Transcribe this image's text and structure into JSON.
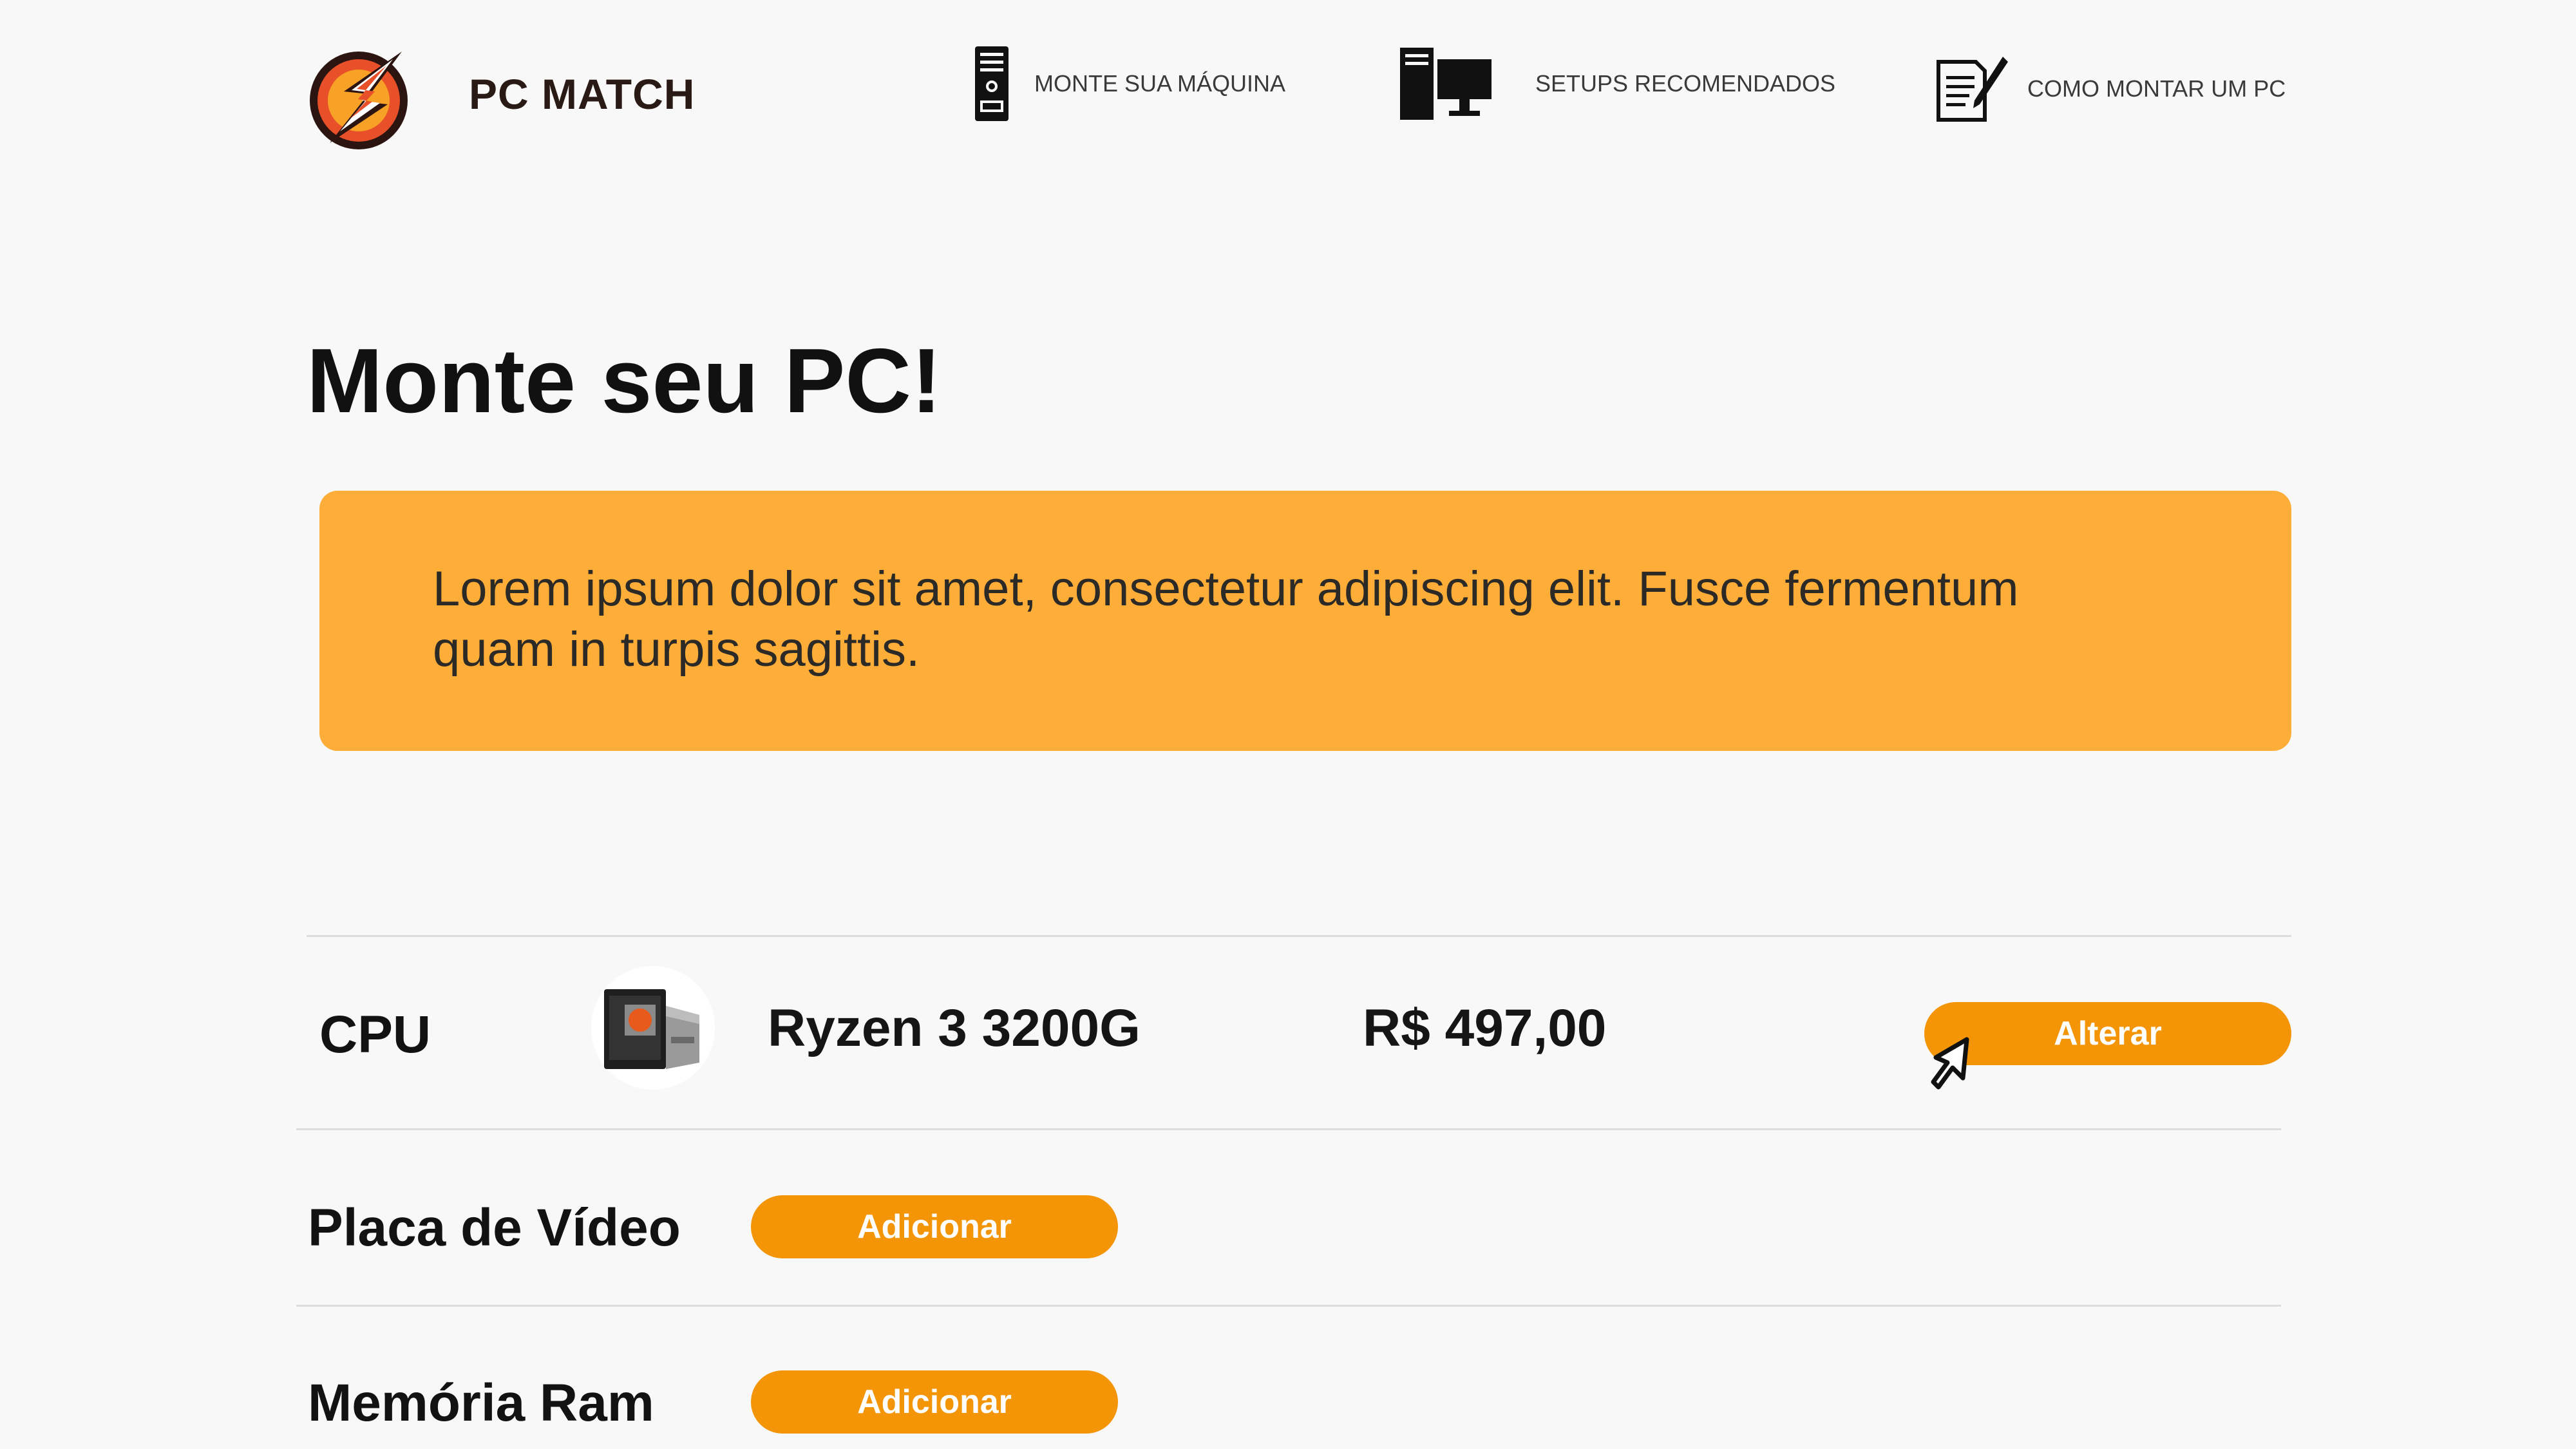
{
  "header": {
    "brand": "PC MATCH",
    "logo_icon": "lightning-bolt-logo-icon",
    "nav": [
      {
        "label": "MONTE SUA MÁQUINA",
        "icon": "pc-tower-icon"
      },
      {
        "label": "SETUPS RECOMENDADOS",
        "icon": "desktop-setup-icon"
      },
      {
        "label": "COMO MONTAR UM PC",
        "icon": "document-pencil-icon"
      }
    ]
  },
  "main": {
    "title": "Monte seu PC!",
    "banner_text": "Lorem ipsum dolor sit amet, consectetur adipiscing elit. Fusce fermentum quam in turpis sagittis."
  },
  "components": {
    "cpu": {
      "label": "CPU",
      "product_name": "Ryzen 3 3200G",
      "price": "R$ 497,00",
      "button": "Alterar"
    },
    "gpu": {
      "label": "Placa de Vídeo",
      "button": "Adicionar"
    },
    "ram": {
      "label": "Memória Ram",
      "button": "Adicionar"
    }
  },
  "colors": {
    "background": "#f8f8f8",
    "banner": "#fdad38",
    "button": "#f39506",
    "brand_text": "#2a1a15"
  }
}
